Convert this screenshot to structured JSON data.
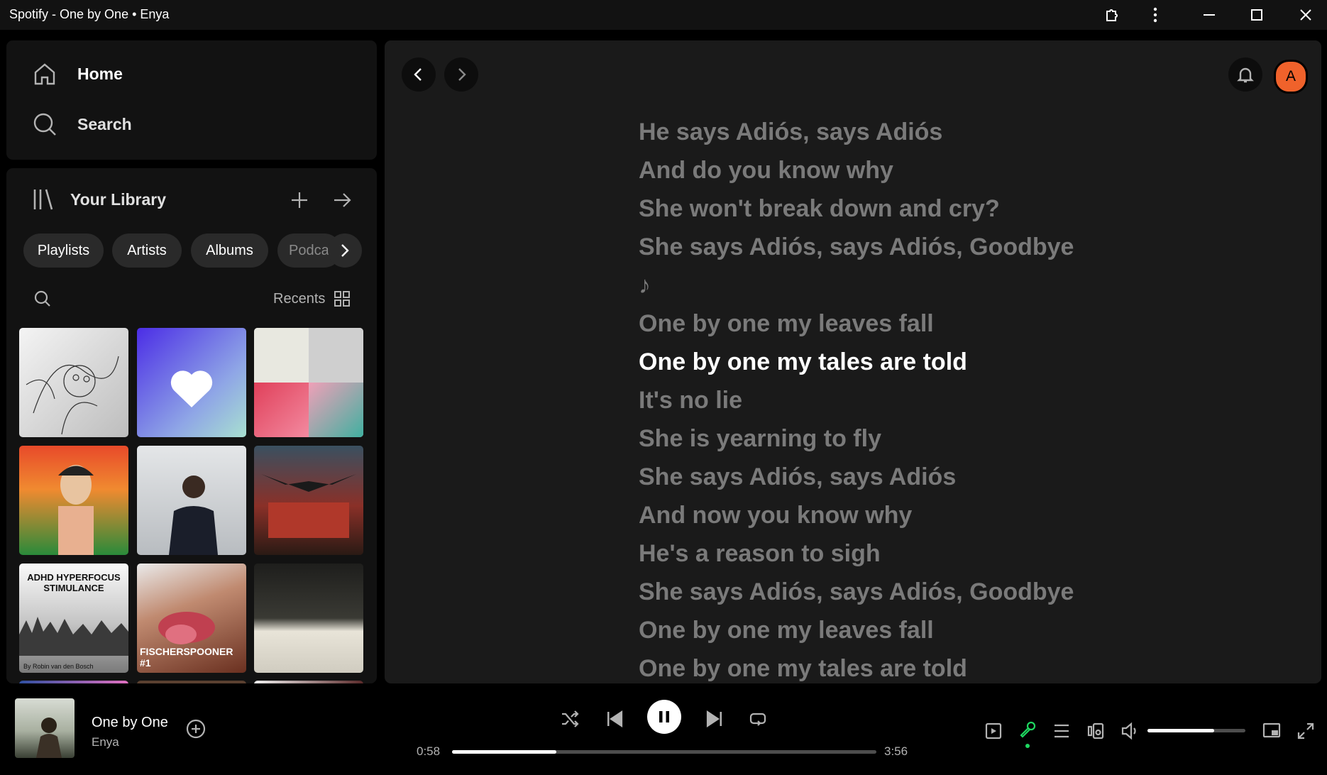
{
  "window": {
    "title": "Spotify - One by One • Enya"
  },
  "nav": {
    "home": "Home",
    "search": "Search"
  },
  "library": {
    "title": "Your Library",
    "chips": [
      "Playlists",
      "Artists",
      "Albums",
      "Podca"
    ],
    "sort_label": "Recents",
    "tiles": [
      {
        "name": "tile-art-sketch",
        "bg": "#e9e9e9"
      },
      {
        "name": "tile-liked-songs",
        "bg": "#7a5cf0"
      },
      {
        "name": "tile-collage",
        "bg": "#c9405a"
      },
      {
        "name": "tile-art-red",
        "bg": "#d8452c"
      },
      {
        "name": "tile-man-portrait",
        "bg": "#c8ccd0"
      },
      {
        "name": "tile-art-eagle",
        "bg": "#6e2422"
      },
      {
        "name": "tile-adhd",
        "bg": "#d9d9d9"
      },
      {
        "name": "tile-fischerspooner",
        "bg": "#b07a60"
      },
      {
        "name": "tile-dark-horizon",
        "bg": "#2a2a26"
      }
    ],
    "adhd_text": "ADHD HYPERFOCUS STIMULANCE",
    "adhd_byline": "By Robin van den Bosch",
    "fischer_text": "FISCHERSPOONER #1"
  },
  "topbar": {
    "avatar_letter": "A"
  },
  "lyrics": {
    "lines": [
      "He says Adiós, says Adiós",
      "And do you know why",
      "She won't break down and cry?",
      "She says Adiós, says Adiós, Goodbye",
      "♪",
      "One by one my leaves fall",
      "One by one my tales are told",
      "It's no lie",
      "She is yearning to fly",
      "She says Adiós, says Adiós",
      "And now you know why",
      "He's a reason to sigh",
      "She says Adiós, says Adiós, Goodbye",
      "One by one my leaves fall",
      "One by one my tales are told"
    ],
    "active_index": 6
  },
  "now_playing": {
    "title": "One by One",
    "artist": "Enya",
    "elapsed": "0:58",
    "duration": "3:56",
    "progress": 0.245,
    "volume": 0.68
  },
  "colors": {
    "accent": "#1ed760",
    "avatar": "#f0622b"
  }
}
